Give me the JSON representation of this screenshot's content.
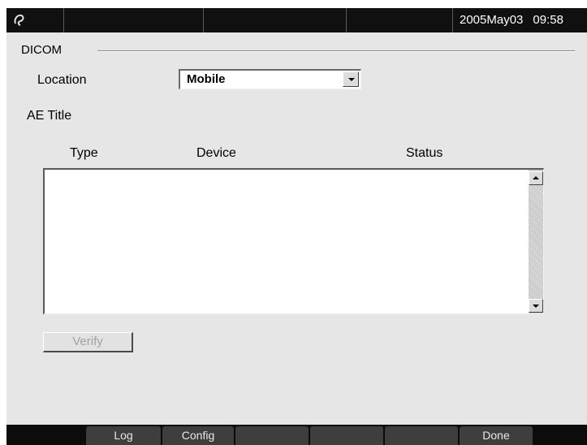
{
  "topbar": {
    "date": "2005May03",
    "time": "09:58"
  },
  "dicom": {
    "group_title": "DICOM",
    "location_label": "Location",
    "location_value": "Mobile",
    "ae_title_label": "AE Title",
    "columns": [
      "Type",
      "Device",
      "Status"
    ],
    "rows": [],
    "verify_label": "Verify"
  },
  "softkeys": [
    "Log",
    "Config",
    "",
    "",
    "",
    "Done"
  ],
  "icons": {
    "logo": "brand-logo-icon",
    "dropdown": "chevron-down-icon",
    "scroll_up": "scroll-up-arrow-icon",
    "scroll_down": "scroll-down-arrow-icon"
  },
  "colors": {
    "bar_background": "#101010",
    "panel_background": "#e6e6e6",
    "softkey_background": "#3e3e3e",
    "disabled_text": "#a2a2a2"
  }
}
